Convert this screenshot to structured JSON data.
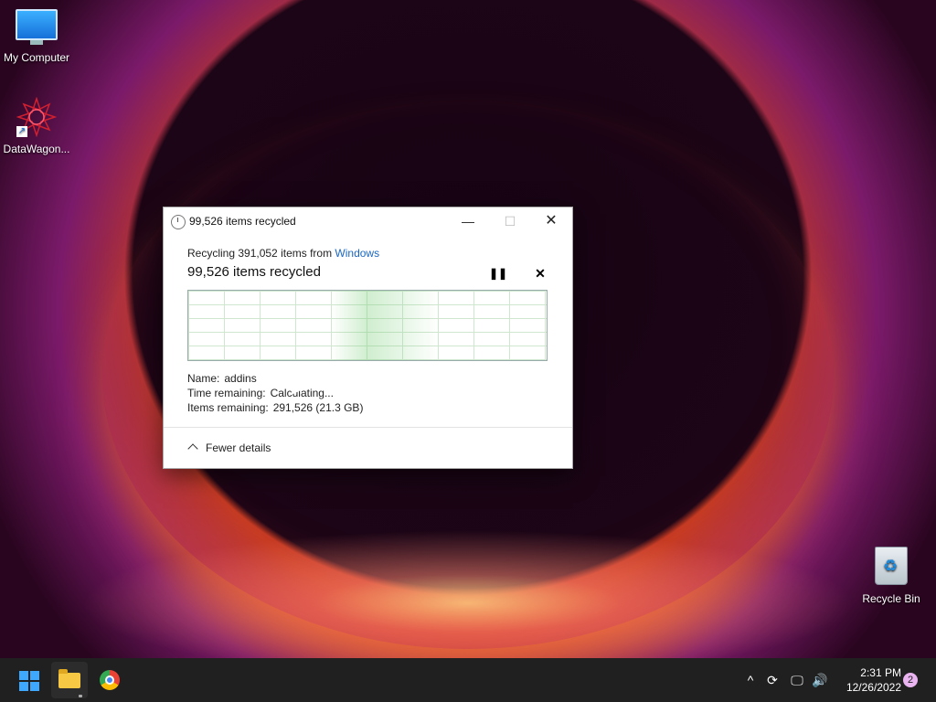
{
  "desktop": {
    "icons": [
      {
        "label": "My Computer",
        "icon": "monitor-icon"
      },
      {
        "label": "DataWagon...",
        "icon": "datawagon-logo-icon"
      },
      {
        "label": "Recycle Bin",
        "icon": "recycle-bin-icon"
      }
    ]
  },
  "dialog": {
    "title": "99,526 items recycled",
    "from_prefix": "Recycling 391,052 items from ",
    "from_link": "Windows",
    "status": "99,526 items recycled",
    "name_label": "Name:",
    "name_value": "addins",
    "time_label": "Time remaining:",
    "time_value": "Calculating...",
    "items_label": "Items remaining:",
    "items_value": "291,526 (21.3 GB)",
    "fewer_details": "Fewer details",
    "pause_glyph": "❚❚",
    "stop_glyph": "✕",
    "minimize_glyph": "—",
    "maximize_glyph": "☐",
    "close_glyph": "✕"
  },
  "taskbar": {
    "apps": [
      "start-icon",
      "file-explorer-icon",
      "chrome-icon"
    ],
    "tray": {
      "chevron": "^",
      "update_glyph": "⟳",
      "network_glyph": "🖵",
      "volume_glyph": "🔊",
      "time": "2:31 PM",
      "date": "12/26/2022",
      "notifications": "2"
    }
  },
  "colors": {
    "accent": "#3ea8ff",
    "link": "#1a66c0",
    "taskbar": "#202020",
    "progress_fill": "#78cd78"
  }
}
